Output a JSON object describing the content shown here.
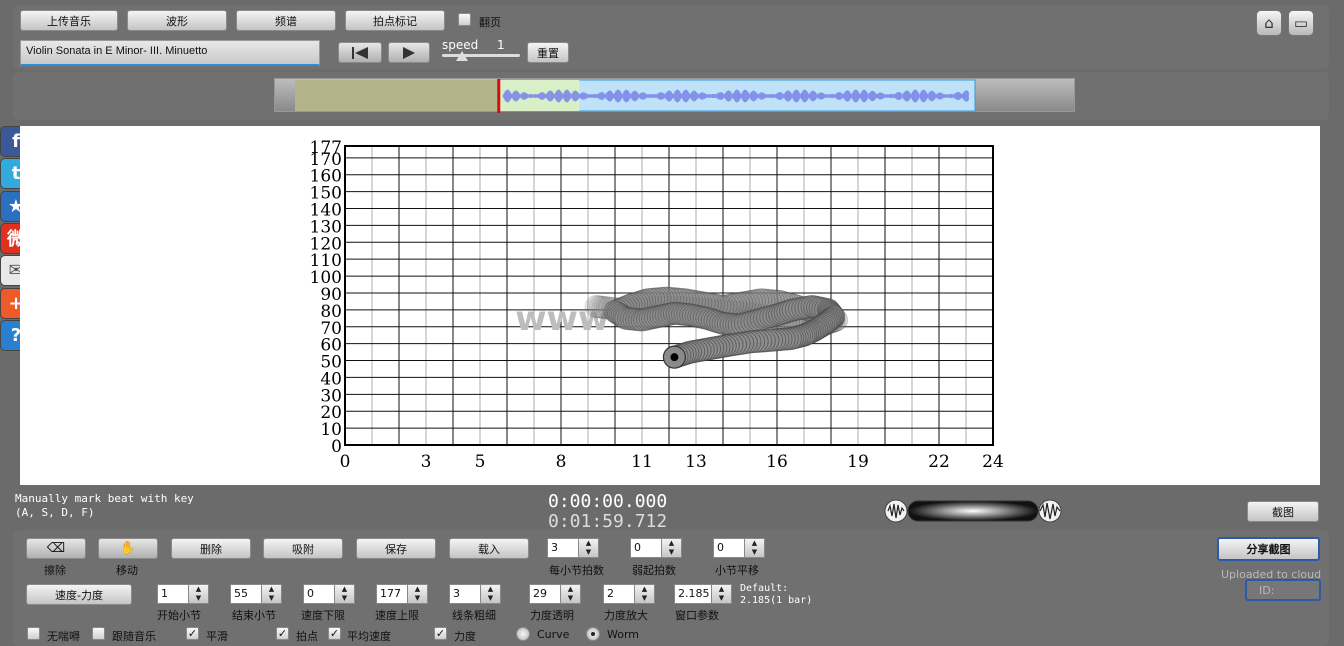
{
  "toolbar": {
    "upload_label": "上传音乐",
    "waveform_label": "波形",
    "spectrum_label": "频谱",
    "beat_mark_label": "拍点标记",
    "page_flip_label": "翻页",
    "page_flip_checked": false,
    "song_title": "Violin Sonata in E Minor- III. Minuetto",
    "speed_label": "speed",
    "speed_value": "1",
    "speed_fraction": 0.25,
    "reset_label": "重置"
  },
  "waveform": {
    "selection_start_fraction": 0.28,
    "selection_end_fraction": 1.0
  },
  "social": [
    {
      "name": "facebook-icon",
      "glyph": "f",
      "color": "#3b5998"
    },
    {
      "name": "twitter-icon",
      "glyph": "t",
      "color": "#33aadd"
    },
    {
      "name": "favorite-star-icon",
      "glyph": "★",
      "color": "#2a6fc0"
    },
    {
      "name": "weibo-icon",
      "glyph": "微",
      "color": "#e0301e"
    },
    {
      "name": "email-icon",
      "glyph": "✉",
      "color": "#e8e8e8"
    },
    {
      "name": "share-plus-icon",
      "glyph": "+",
      "color": "#f05a28"
    },
    {
      "name": "help-icon",
      "glyph": "?",
      "color": "#2a80d0"
    }
  ],
  "chart_data": {
    "type": "scatter",
    "x_ticks": [
      "0",
      "3",
      "5",
      "8",
      "11",
      "13",
      "16",
      "19",
      "22",
      "24"
    ],
    "y_ticks": [
      "0",
      "10",
      "20",
      "30",
      "40",
      "50",
      "60",
      "70",
      "80",
      "90",
      "100",
      "110",
      "120",
      "130",
      "140",
      "150",
      "160",
      "170",
      "177"
    ],
    "xlim": [
      0,
      24
    ],
    "ylim": [
      0,
      177
    ],
    "grid": true,
    "watermark": "www",
    "trail": [
      {
        "x": 12.2,
        "y": 52
      },
      {
        "x": 12.8,
        "y": 55
      },
      {
        "x": 13.5,
        "y": 57
      },
      {
        "x": 14.2,
        "y": 59
      },
      {
        "x": 15.0,
        "y": 61
      },
      {
        "x": 15.8,
        "y": 62
      },
      {
        "x": 16.5,
        "y": 63
      },
      {
        "x": 17.0,
        "y": 65
      },
      {
        "x": 17.4,
        "y": 68
      },
      {
        "x": 17.8,
        "y": 72
      },
      {
        "x": 18.1,
        "y": 76
      },
      {
        "x": 17.9,
        "y": 80
      },
      {
        "x": 17.3,
        "y": 82
      },
      {
        "x": 16.6,
        "y": 80
      },
      {
        "x": 16.0,
        "y": 77
      },
      {
        "x": 15.3,
        "y": 74
      },
      {
        "x": 14.6,
        "y": 71
      },
      {
        "x": 14.0,
        "y": 72
      },
      {
        "x": 13.4,
        "y": 75
      },
      {
        "x": 12.8,
        "y": 77
      },
      {
        "x": 12.2,
        "y": 78
      },
      {
        "x": 11.6,
        "y": 76
      },
      {
        "x": 11.0,
        "y": 74
      },
      {
        "x": 10.4,
        "y": 75
      },
      {
        "x": 10.0,
        "y": 79
      },
      {
        "x": 10.6,
        "y": 83
      },
      {
        "x": 11.2,
        "y": 86
      },
      {
        "x": 11.9,
        "y": 87
      },
      {
        "x": 12.6,
        "y": 86
      },
      {
        "x": 13.3,
        "y": 84
      },
      {
        "x": 14.0,
        "y": 82
      },
      {
        "x": 14.7,
        "y": 84
      },
      {
        "x": 15.4,
        "y": 86
      },
      {
        "x": 16.1,
        "y": 85
      },
      {
        "x": 16.8,
        "y": 82
      },
      {
        "x": 17.5,
        "y": 78
      },
      {
        "x": 18.2,
        "y": 74
      },
      {
        "x": 17.7,
        "y": 71
      },
      {
        "x": 17.0,
        "y": 72
      },
      {
        "x": 16.3,
        "y": 74
      },
      {
        "x": 15.6,
        "y": 76
      },
      {
        "x": 14.9,
        "y": 78
      },
      {
        "x": 14.2,
        "y": 79
      },
      {
        "x": 13.5,
        "y": 80
      },
      {
        "x": 12.8,
        "y": 81
      },
      {
        "x": 12.0,
        "y": 82
      },
      {
        "x": 11.3,
        "y": 81
      },
      {
        "x": 10.5,
        "y": 80
      },
      {
        "x": 9.8,
        "y": 81
      },
      {
        "x": 9.3,
        "y": 82
      }
    ],
    "current": {
      "x": 12.2,
      "y": 52
    }
  },
  "status": {
    "hint_line1": "Manually mark beat with key",
    "hint_line2": "(A, S, D, F)",
    "current_time": "0:00:00.000",
    "total_time": "0:01:59.712",
    "screenshot_label": "截图"
  },
  "controls": {
    "eraser_label": "擦除",
    "move_label": "移动",
    "delete_label": "删除",
    "snap_label": "吸附",
    "save_label": "保存",
    "load_label": "载入",
    "beats_per_bar_label": "每小节拍数",
    "beats_per_bar": "3",
    "upbeat_label": "弱起拍数",
    "upbeat": "0",
    "bar_shift_label": "小节平移",
    "bar_shift": "0",
    "mode_label": "速度-力度",
    "start_bar_label": "开始小节",
    "start_bar": "1",
    "end_bar_label": "结束小节",
    "end_bar": "55",
    "tempo_min_label": "速度下限",
    "tempo_min": "0",
    "tempo_max_label": "速度上限",
    "tempo_max": "177",
    "line_width_label": "线条粗细",
    "line_width": "3",
    "opacity_label": "力度透明",
    "opacity": "29",
    "dyn_scale_label": "力度放大",
    "dyn_scale": "2",
    "window_label": "窗口参数",
    "window": "2.185",
    "default_line1": "Default:",
    "default_line2": "2.185(1 bar)",
    "share_label": "分享截图",
    "uploaded_label": "Uploaded to cloud",
    "id_label": "ID:",
    "no_vertical_label": "无喘嘚",
    "follow_music_label": "跟随音乐",
    "smooth_label": "平滑",
    "smooth": true,
    "beat_point_label": "拍点",
    "beat_point": true,
    "avg_tempo_label": "平均速度",
    "avg_tempo": true,
    "dynamics_label": "力度",
    "dynamics": true,
    "curve_label": "Curve",
    "worm_label": "Worm",
    "worm_selected": true
  }
}
